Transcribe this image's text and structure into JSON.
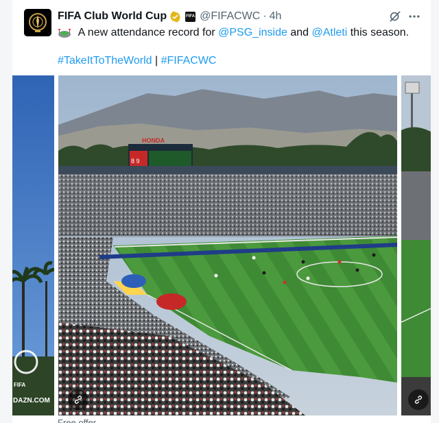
{
  "tweet": {
    "author_name": "FIFA Club World Cup",
    "affiliate_badge": "FIFA",
    "handle": "@FIFACWC",
    "separator": "·",
    "time": "4h",
    "text_intro": " A new attendance record for ",
    "mention_1": "@PSG_inside",
    "text_and": " and ",
    "mention_2": "@Atleti",
    "text_tail": " this season.",
    "hashtag_1": "#TakeItToTheWorld",
    "hashtag_sep": " | ",
    "hashtag_2": "#FIFACWC",
    "caption_cut": "Free offer"
  },
  "media": {
    "left_panel": {
      "badge_text": "FIFA",
      "watermark": "DAZN.COM"
    },
    "main_panel": {
      "billboard": "HONDA",
      "scoreboard": "8 9"
    }
  },
  "colors": {
    "link": "#1d9bf0",
    "verified_gold": "#e2b719",
    "muted": "#536471",
    "pitch_green": "#3f8a34"
  },
  "icons": {
    "verified": "verified-badge-icon",
    "grok": "grok-icon",
    "more": "more-options-icon",
    "emoji": "stadium-emoji-icon",
    "link": "link-icon"
  }
}
